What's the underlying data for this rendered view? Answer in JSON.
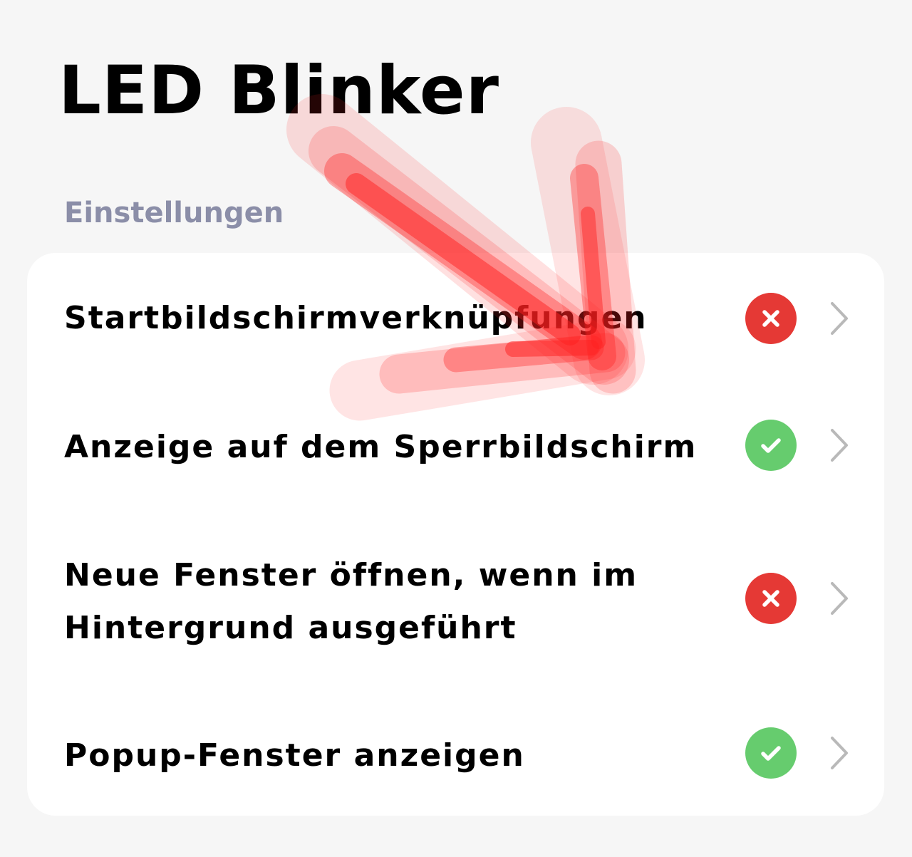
{
  "header": {
    "title": "LED Blinker"
  },
  "settings": {
    "section_label": "Einstellungen",
    "items": [
      {
        "label": "Startbildschirmverknüpfungen",
        "status": "denied",
        "status_icon": "cross-icon",
        "status_color": "#e53935"
      },
      {
        "label": "Anzeige auf dem Sperrbildschirm",
        "status": "allowed",
        "status_icon": "check-icon",
        "status_color": "#66cc6e"
      },
      {
        "label_line1": "Neue Fenster öffnen, wenn im",
        "label_line2": "Hintergrund ausgeführt",
        "status": "denied",
        "status_icon": "cross-icon",
        "status_color": "#e53935"
      },
      {
        "label": "Popup-Fenster anzeigen",
        "status": "allowed",
        "status_icon": "check-icon",
        "status_color": "#66cc6e"
      }
    ]
  },
  "annotation": {
    "icon": "red-arrow-icon",
    "color": "#ff2020"
  }
}
